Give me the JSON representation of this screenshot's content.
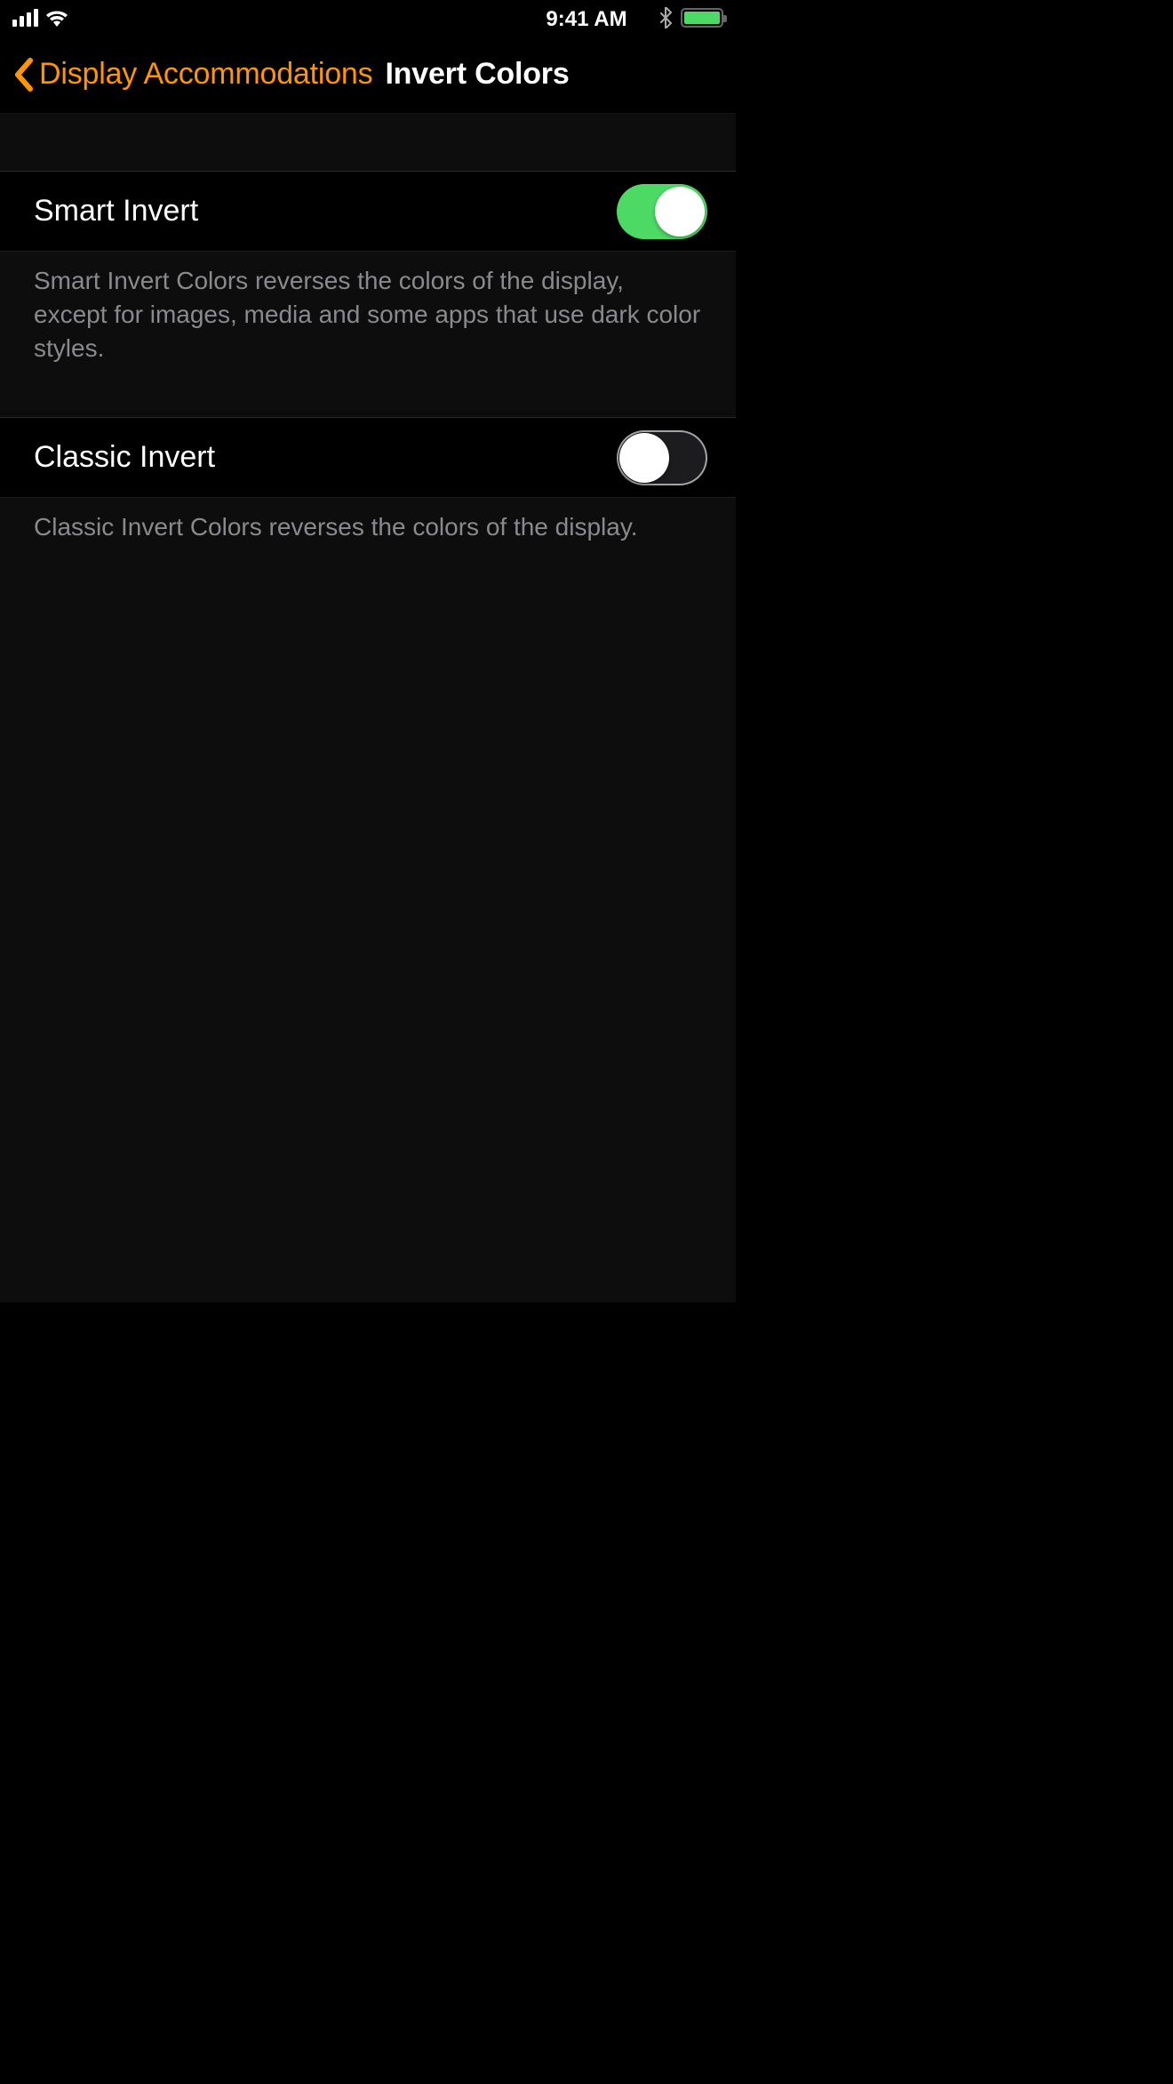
{
  "status_bar": {
    "time": "9:41 AM"
  },
  "nav": {
    "back_label": "Display Accommodations",
    "title": "Invert Colors"
  },
  "sections": {
    "smart_invert": {
      "label": "Smart Invert",
      "enabled": true,
      "footer": "Smart Invert Colors reverses the colors of the display, except for images, media and some apps that use dark color styles."
    },
    "classic_invert": {
      "label": "Classic Invert",
      "enabled": false,
      "footer": "Classic Invert Colors reverses the colors of the display."
    }
  },
  "colors": {
    "accent": "#ff9500",
    "switch_on": "#4cd964"
  }
}
